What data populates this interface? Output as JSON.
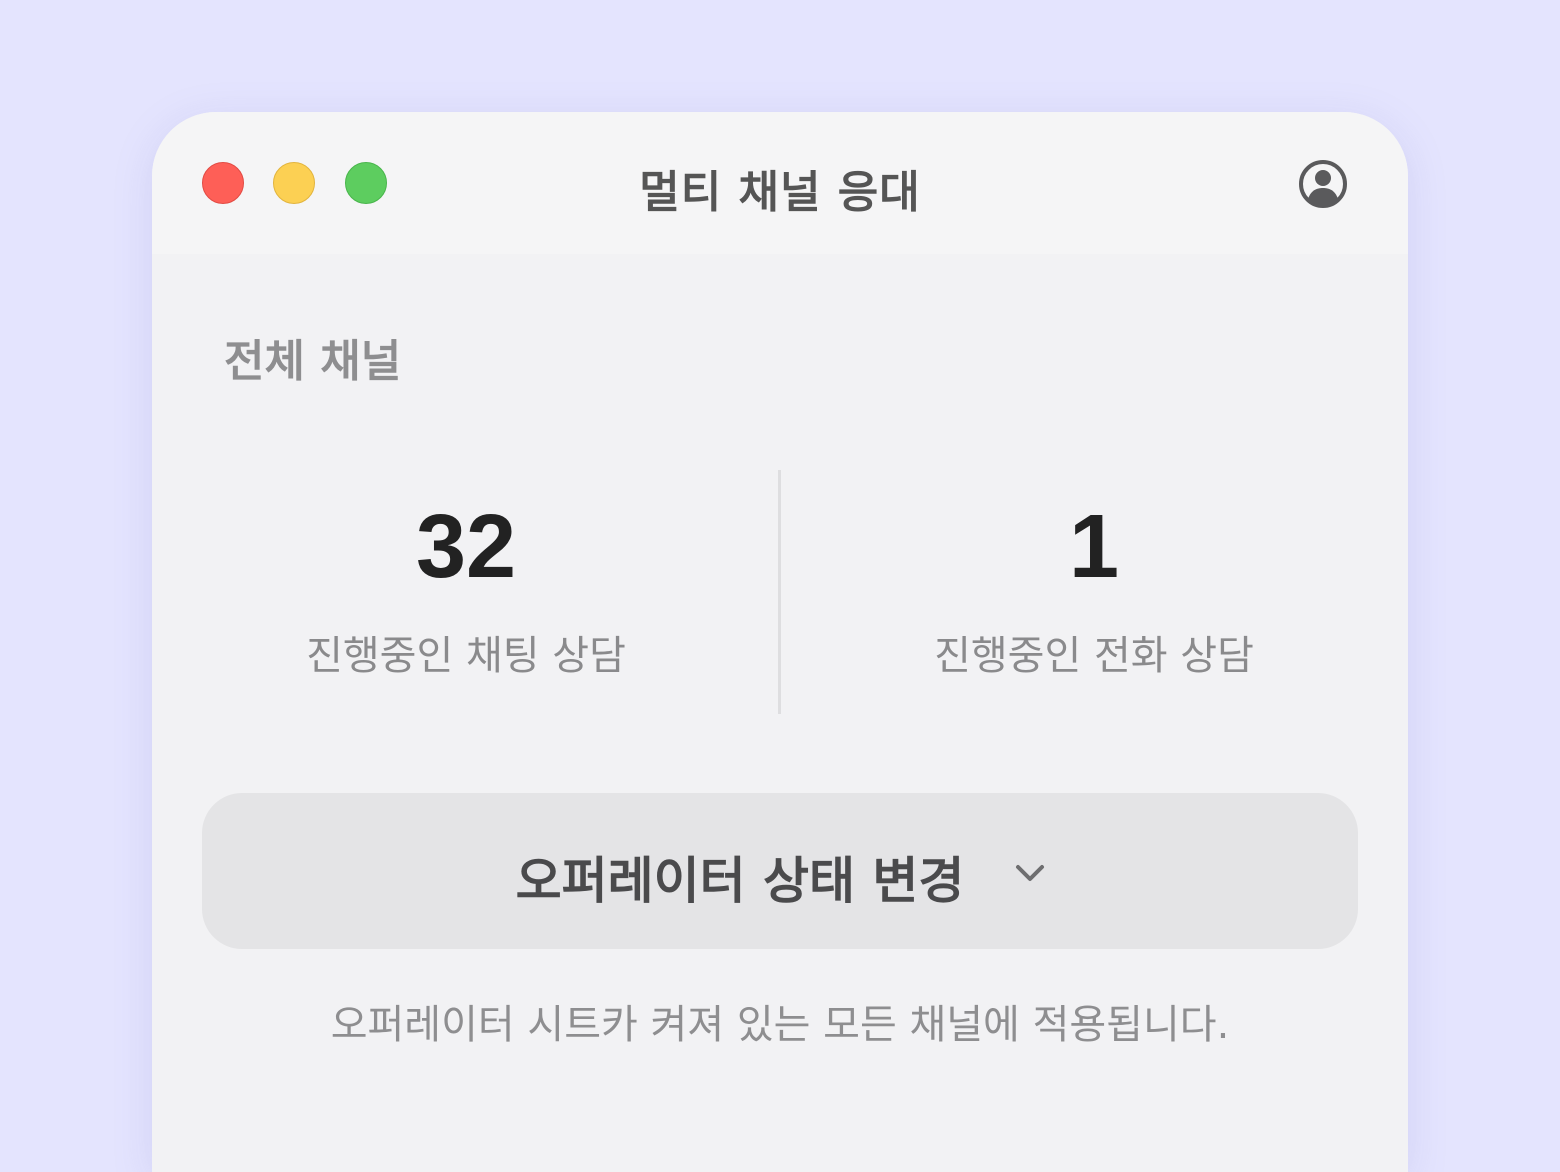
{
  "window": {
    "title": "멀티 채널 응대",
    "traffic_lights": [
      "close",
      "minimize",
      "maximize"
    ],
    "account_icon": "user-circle-icon"
  },
  "section": {
    "title": "전체 채널"
  },
  "stats": [
    {
      "value": "32",
      "label": "진행중인 채팅 상담"
    },
    {
      "value": "1",
      "label": "진행중인 전화 상담"
    }
  ],
  "status_button": {
    "label": "오퍼레이터 상태 변경",
    "icon": "chevron-down-icon"
  },
  "footnote": "오퍼레이터 시트카 켜져 있는 모든 채널에 적용됩니다.",
  "colors": {
    "background": "#e4e4fe",
    "window": "#f2f2f4",
    "titlebar": "#f5f5f6",
    "close": "#fe5f57",
    "minimize": "#fcd053",
    "maximize": "#5dcd5f",
    "button": "#e4e4e6"
  }
}
